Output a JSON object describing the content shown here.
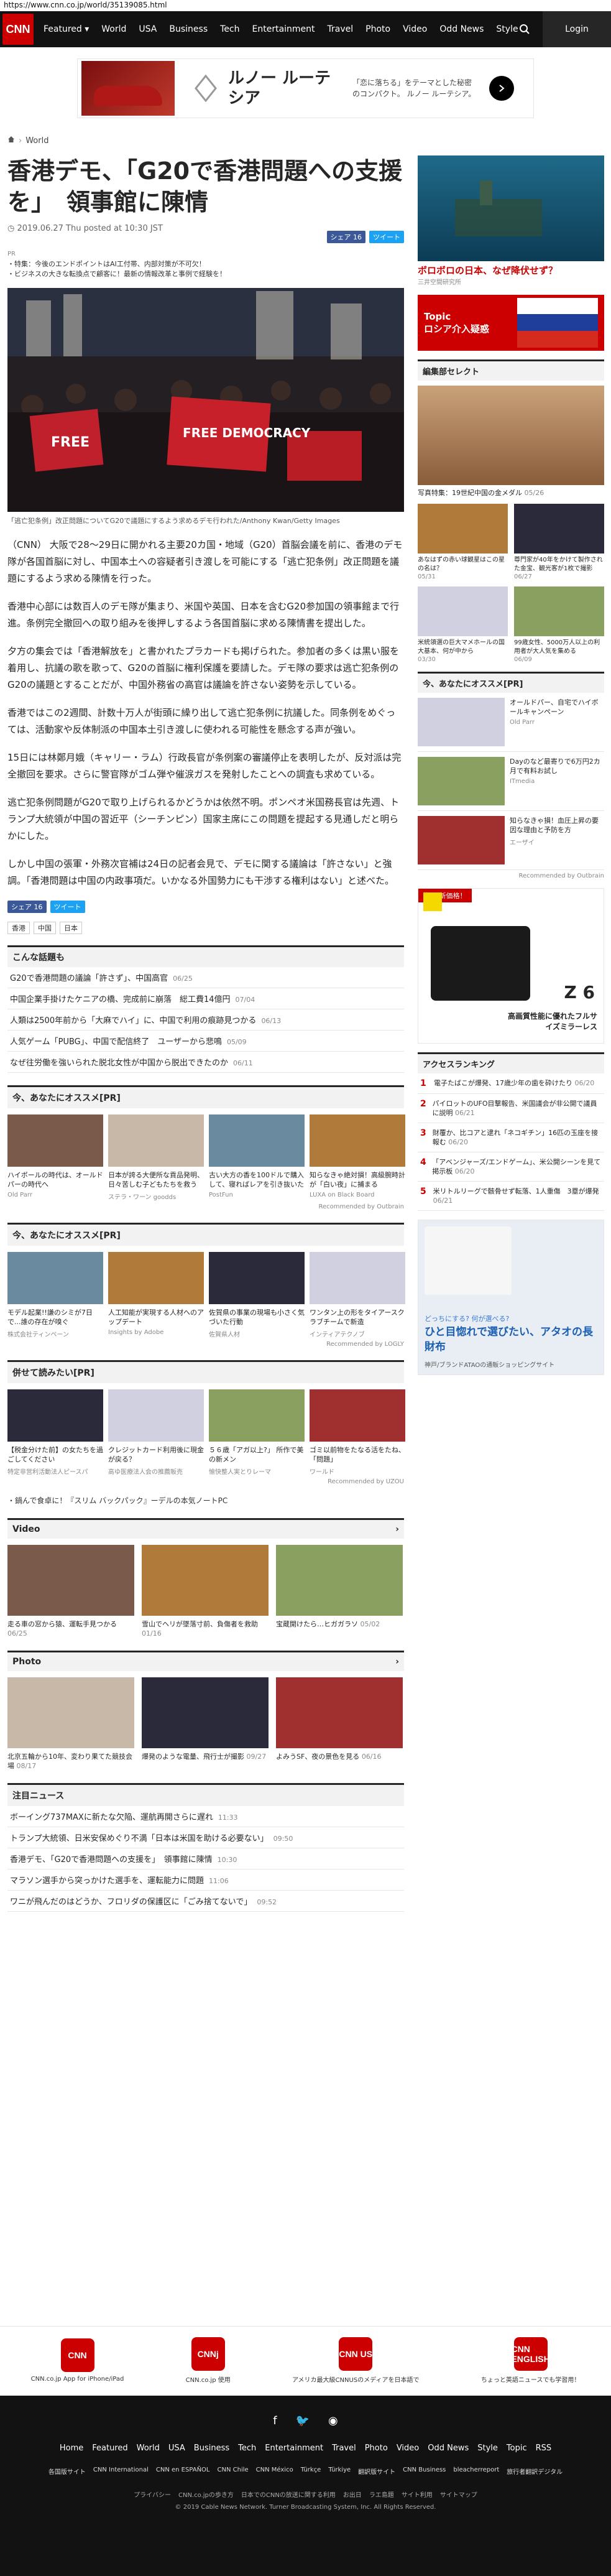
{
  "url": "https://www.cnn.co.jp/world/35139085.html",
  "nav": {
    "logo": "CNN",
    "items": [
      "Featured ▾",
      "World",
      "USA",
      "Business",
      "Tech",
      "Entertainment",
      "Travel",
      "Photo",
      "Video",
      "Odd News",
      "Style"
    ],
    "login": "Login"
  },
  "ad_top": {
    "title": "ルノー ルーテシア",
    "body": "「恋に落ちる」をテーマとした秘密のコンパクト。 ルノー ルーテシア。"
  },
  "breadcrumb": "World",
  "article": {
    "title": "香港デモ、「G20で香港問題への支援を」　領事館に陳情",
    "date": "2019.06.27 Thu posted at 10:30 JST",
    "fb": "シェア 16",
    "tw": "ツイート",
    "pr_label": "PR",
    "pr1": "・特集：今後のエンドポイントはAI工付帯、内部対策が不可欠！",
    "pr2": "・ビジネスの大きな転換点で顧客に！最新の情報改革と事例で経験を！",
    "caption": "「逃亡犯条例」改正問題についてG20で議題にするよう求めるデモ行われた/Anthony Kwan/Getty Images",
    "sign1": "FREE",
    "sign2": "FREE DEMOCRACY",
    "paragraphs": [
      "（CNN） 大阪で28～29日に開かれる主要20カ国・地域（G20）首脳会議を前に、香港のデモ隊が各国首脳に対し、中国本土への容疑者引き渡しを可能にする「逃亡犯条例」改正問題を議題にするよう求める陳情を行った。",
      "香港中心部には数百人のデモ隊が集まり、米国や英国、日本を含むG20参加国の領事館まで行進。条例完全撤回への取り組みを後押しするよう各国首脳に求める陳情書を提出した。",
      "夕方の集会では「香港解放を」と書かれたプラカードも掲げられた。参加者の多くは黒い服を着用し、抗議の歌を歌って、G20の首脳に権利保護を要請した。デモ隊の要求は逃亡犯条例のG20の議題とすることだが、中国外務省の高官は議論を許さない姿勢を示している。",
      "香港ではこの2週間、計数十万人が街頭に繰り出して逃亡犯条例に抗議した。同条例をめぐっては、活動家や反体制派の中国本土引き渡しに使われる可能性を懸念する声が強い。",
      "15日には林鄭月娥（キャリー・ラム）行政長官が条例案の審議停止を表明したが、反対派は完全撤回を要求。さらに警官隊がゴム弾や催涙ガスを発射したことへの調査も求めている。",
      "逃亡犯条例問題がG20で取り上げられるかどうかは依然不明。ポンペオ米国務長官は先週、トランプ大統領が中国の習近平（シーチンピン）国家主席にこの問題を提起する見通しだと明らかにした。",
      "しかし中国の張軍・外務次官補は24日の記者会見で、デモに関する議論は「許さない」と強調。「香港問題は中国の内政事項だ。いかなる外国勢力にも干渉する権利はない」と述べた。"
    ],
    "tags": [
      "香港",
      "中国",
      "日本"
    ]
  },
  "related": {
    "heading": "こんな話題も",
    "items": [
      {
        "t": "G20で香港問題の議論「許さず」、中国高官",
        "d": "06/25"
      },
      {
        "t": "中国企業手掛けたケニアの橋、完成前に崩落　総工費14億円",
        "d": "07/04"
      },
      {
        "t": "人類は2500年前から「大麻でハイ」に、中国で利用の痕跡見つかる",
        "d": "06/13"
      },
      {
        "t": "人気ゲーム「PUBG」、中国で配信終了　ユーザーから悲鳴",
        "d": "05/09"
      },
      {
        "t": "なぜ往労働を強いられた脱北女性が中国から脱出できたのか",
        "d": "06/11"
      }
    ]
  },
  "rec1": {
    "heading": "今、あなたにオススメ[PR]",
    "items": [
      {
        "t": "ハイボールの時代は、オールドパーの時代へ",
        "s": "Old Parr"
      },
      {
        "t": "日本が誇る大便所な貢品発明、日々苦しむ子どもたちを救う",
        "s": "ステラ・ワーン goodds"
      },
      {
        "t": "古い大方の香を100ドルで購入して、寝ればレアを引き抜いた",
        "s": "PostFun"
      },
      {
        "t": "知らなきゃ絶対損！高級腕時計が「白い夜」に捕まる",
        "s": "LUXA on Black Board"
      }
    ]
  },
  "rec2": {
    "heading": "今、あなたにオススメ[PR]",
    "items": [
      {
        "t": "モデル起業!!謙のシミが7日で...誰の存在が嗅ぐ",
        "s": "株式会社ティンペーン"
      },
      {
        "t": "人工知能が実現する人材へのアップデート",
        "s": "Insights by Adobe"
      },
      {
        "t": "佐賀県の事業の現場も小さく気づいた行動",
        "s": "佐賀県人材"
      },
      {
        "t": "ワンタン上の形をタイアースクラブチームで新造",
        "s": "インティアテクノブ"
      }
    ]
  },
  "rec3": {
    "heading": "併せて読みたい[PR]",
    "items": [
      {
        "t": "【税金分けた前】の女たちを過ごしてください",
        "s": "特定非営利活動法人ピースパ"
      },
      {
        "t": "クレジットカード利用後に現金が戻る？",
        "s": "高ゆ医療法人会の推薦販売"
      },
      {
        "t": "５６歳「アガ以上?」 所作で美の新メン",
        "s": "愉快整人実とりレーマ"
      },
      {
        "t": "ゴミ以前物をたなる活をたね、「問題」",
        "s": "ワールド"
      }
    ]
  },
  "pr_line": "・鍋んで食卓に！『スリム バックパック』ーデルの本気ノートPC",
  "video": {
    "heading": "Video",
    "items": [
      {
        "t": "走る車の窓から猿、運転手見つかる",
        "d": "06/25"
      },
      {
        "t": "雪山でヘリが墜落寸前、負傷者を救助",
        "d": "01/16"
      },
      {
        "t": "宝蔵開けたら…ヒガガラソ",
        "d": "05/02"
      }
    ]
  },
  "photo": {
    "heading": "Photo",
    "items": [
      {
        "t": "北京五輪から10年、変わり果てた競技会場",
        "d": "08/17"
      },
      {
        "t": "爆発のような電量、飛行士が撮影",
        "d": "09/27"
      },
      {
        "t": "よみうSF、夜の景色を見る",
        "d": "06/16"
      }
    ]
  },
  "attention": {
    "heading": "注目ニュース",
    "items": [
      {
        "t": "ボーイング737MAXに新たな欠陥、運航再開さらに遅れ",
        "d": "11:33"
      },
      {
        "t": "トランプ大統領、日米安保めぐり不満「日本は米国を助ける必要ない」",
        "d": "09:50"
      },
      {
        "t": "香港デモ、「G20で香港問題への支援を」　領事館に陳情",
        "d": "10:30"
      },
      {
        "t": "マラソン選手から突っかけた選手を、運転能力に問題",
        "d": "11:06"
      },
      {
        "t": "ワニが飛んだのはどうか、フロリダの保護区に「ごみ捨てないで」",
        "d": "09:52"
      }
    ]
  },
  "side": {
    "ad1": "ボロボロの日本、なぜ降伏せず？",
    "ad1s": "三井空間研究所",
    "ad2": "Topic\nロシア介入疑惑",
    "editor_h": "編集部セレクト",
    "ed_main": "写真特集：19世紀中国の金メダル",
    "ed_main_d": "05/26",
    "ed": [
      {
        "t": "あなはずの赤い球観星はこの星の名は？",
        "d": "05/31"
      },
      {
        "t": "尊門家が40年をかけて製作された金宝、観光客が1枚で撮影",
        "d": "06/27"
      },
      {
        "t": "米統領選の巨大マメホールの国大基本、何が中から",
        "d": "03/30"
      },
      {
        "t": "99歳女性、5000万人以上の利用者が大人気を集める",
        "d": "06/09"
      }
    ],
    "rec_h": "今、あなたにオススメ[PR]",
    "recs": [
      {
        "t": "オールドパー、自宅でハイボールキャンペーン",
        "s": "Old Parr"
      },
      {
        "t": "Dayのなど最寄りで6万円2カ月で有料お試し",
        "s": "ITmedia"
      },
      {
        "t": "知らなきゃ損！血圧上昇の要因な理由と予防を方",
        "s": "エーザイ"
      }
    ],
    "nikon_model": "Z 6",
    "nikon_copy": "高画質性能に優れたフルサイズミラーレス",
    "nikon_badge": "権 R 新価格！",
    "rank_h": "アクセスランキング",
    "rank": [
      {
        "t": "電子たばこが爆発、17歳少年の歯を砕けたり",
        "d": "06/20"
      },
      {
        "t": "パイロットのUFO目撃報告、米国議会が非公開で議員に説明",
        "d": "06/21"
      },
      {
        "t": "財覆か、比コアと逮れ「ネコギチン」16匹の玉座を接報む",
        "d": "06/20"
      },
      {
        "t": "「アベンジャーズ/エンドゲーム」、米公開シーンを見て掲示板",
        "d": "06/20"
      },
      {
        "t": "米リトルリーグで骸骨せず転落、1人重傷　3塁が爆発",
        "d": "06/21"
      }
    ],
    "ad3_top": "どっちにする? 何が選べる?",
    "ad3": "ひと目惚れで選びたい、アタオの長財布",
    "ad3s": "神戸/ブランドATAOの通販ショッピングサイト"
  },
  "apps": [
    "CNN.co.jp App for iPhone/iPad",
    "CNN.co.jp 使用",
    "アメリカ最大級CNNUSのメディアを日本語で",
    "ちょっと英語ニュースでも学習用！"
  ],
  "apps_icons": [
    "CNN",
    "CNNj",
    "CNN US",
    "CNN ENGLISH"
  ],
  "footer": {
    "links": [
      "Home",
      "Featured",
      "World",
      "USA",
      "Business",
      "Tech",
      "Entertainment",
      "Travel",
      "Photo",
      "Video",
      "Odd News",
      "Style",
      "Topic",
      "RSS"
    ],
    "intl": [
      "各国版サイト",
      "CNN International",
      "CNN en ESPAÑOL",
      "CNN Chile",
      "CNN México",
      "Türkçe",
      "Türkiye",
      "翻訳版サイト",
      "CNN Business",
      "bleacherreport",
      "旅行者翻訳デジタル"
    ],
    "small": [
      "プライバシー",
      "CNN.co.jpの歩き方",
      "日本でのCNNの放送に関する利用",
      "お出日",
      "ラエ島題",
      "サイト利用",
      "サイトマップ"
    ],
    "copy": "© 2019 Cable News Network. Turner Broadcasting System, Inc. All Rights Reserved."
  },
  "colors": {
    "brand": "#cc0000",
    "nav_bg": "#121212",
    "fb": "#3b5998",
    "tw": "#1da1f2"
  }
}
